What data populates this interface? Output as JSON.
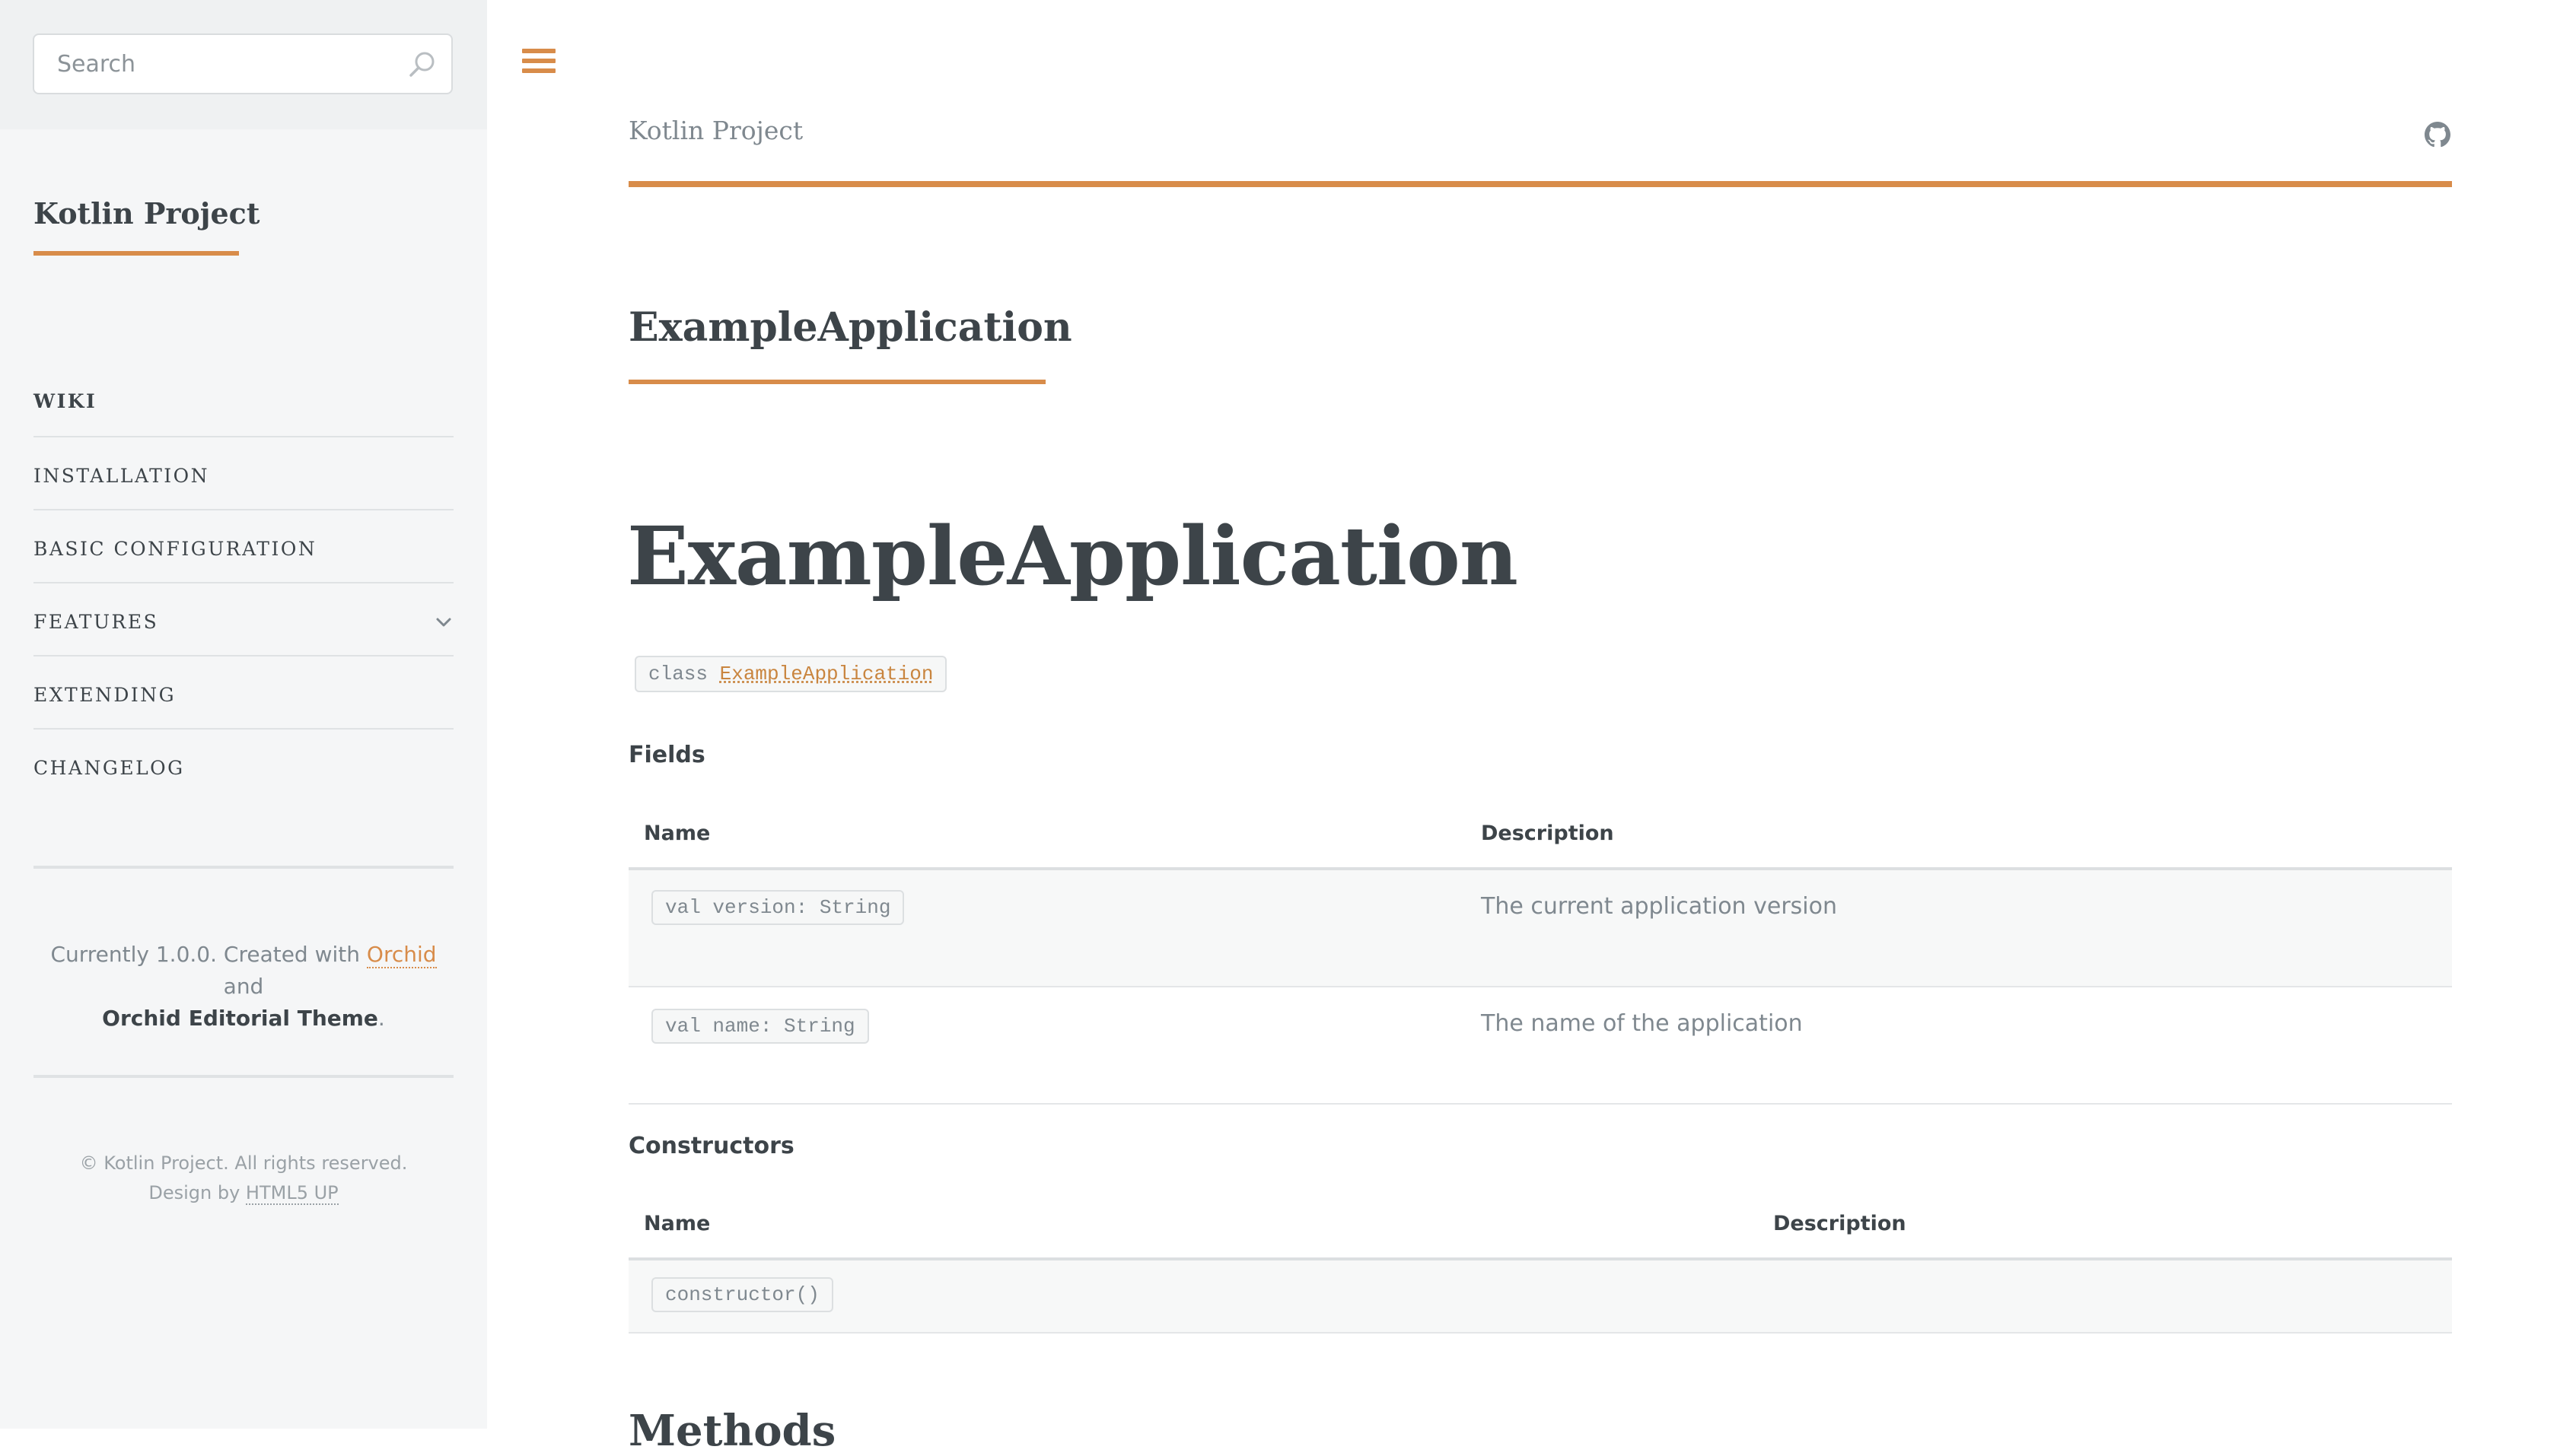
{
  "sidebar": {
    "search_placeholder": "Search",
    "brand": "Kotlin Project",
    "nav": [
      {
        "label": "WIKI"
      },
      {
        "label": "INSTALLATION"
      },
      {
        "label": "BASIC CONFIGURATION"
      },
      {
        "label": "FEATURES"
      },
      {
        "label": "EXTENDING"
      },
      {
        "label": "CHANGELOG"
      }
    ],
    "meta": {
      "prefix": "Currently 1.0.0. Created with ",
      "orchid_link": "Orchid",
      "and": " and",
      "theme": "Orchid Editorial Theme",
      "suffix": "."
    },
    "copyright": "© Kotlin Project. All rights reserved.",
    "design_prefix": "Design by ",
    "design_link": "HTML5 UP"
  },
  "header": {
    "title": "Kotlin Project"
  },
  "main": {
    "section_title": "ExampleApplication",
    "page_title": "ExampleApplication",
    "class_keyword": "class",
    "class_name": "ExampleApplication",
    "fields": {
      "heading": "Fields",
      "col_name": "Name",
      "col_desc": "Description",
      "rows": [
        {
          "sig": "val version: String",
          "desc": "The current application version"
        },
        {
          "sig": "val name: String",
          "desc": "The name of the application"
        }
      ]
    },
    "constructors": {
      "heading": "Constructors",
      "col_name": "Name",
      "col_desc": "Description",
      "rows": [
        {
          "sig": "constructor()",
          "desc": ""
        }
      ]
    },
    "methods_heading": "Methods"
  },
  "colors": {
    "accent": "#d88c4a",
    "heading": "#3d4449",
    "body_text": "#7f888f",
    "sidebar_bg": "#f5f6f7"
  },
  "icons": {
    "search": "search-icon",
    "menu": "hamburger-menu-icon",
    "github": "github-icon",
    "chevron": "chevron-down-icon"
  }
}
